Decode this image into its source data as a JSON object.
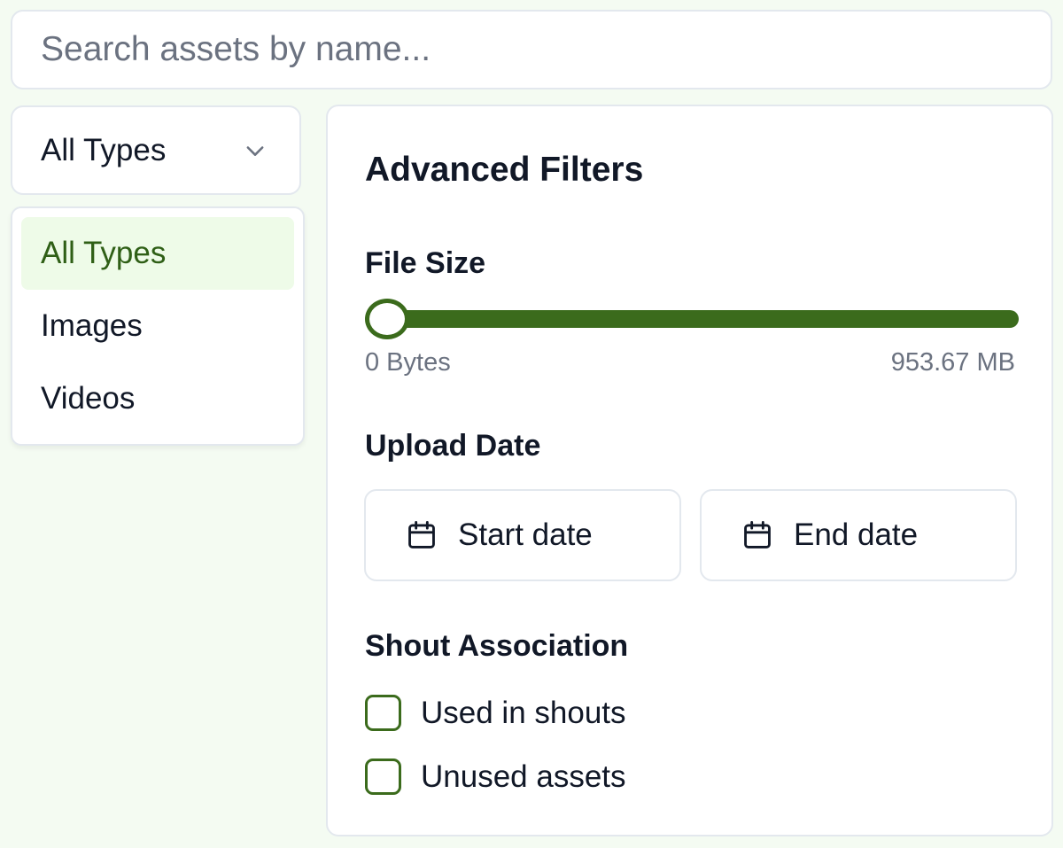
{
  "search": {
    "placeholder": "Search assets by name...",
    "value": ""
  },
  "type_filter": {
    "selected_label": "All Types",
    "icon": "chevron-down-icon",
    "options": [
      {
        "label": "All Types",
        "selected": true
      },
      {
        "label": "Images",
        "selected": false
      },
      {
        "label": "Videos",
        "selected": false
      }
    ]
  },
  "advanced_filters": {
    "title": "Advanced Filters",
    "file_size": {
      "label": "File Size",
      "min_label": "0 Bytes",
      "max_label": "953.67 MB",
      "thumb_position_fraction": 0.0
    },
    "upload_date": {
      "label": "Upload Date",
      "start_label": "Start date",
      "end_label": "End date",
      "icon": "calendar-icon"
    },
    "shout_association": {
      "label": "Shout Association",
      "options": [
        {
          "label": "Used in shouts",
          "checked": false
        },
        {
          "label": "Unused assets",
          "checked": false
        }
      ]
    }
  },
  "colors": {
    "accent": "#3b6b1c",
    "selected_bg": "#eefbe8",
    "selected_text": "#2f5f16",
    "page_bg": "#f4fbf2",
    "border": "#e3e8ee",
    "muted_text": "#6b7280"
  }
}
